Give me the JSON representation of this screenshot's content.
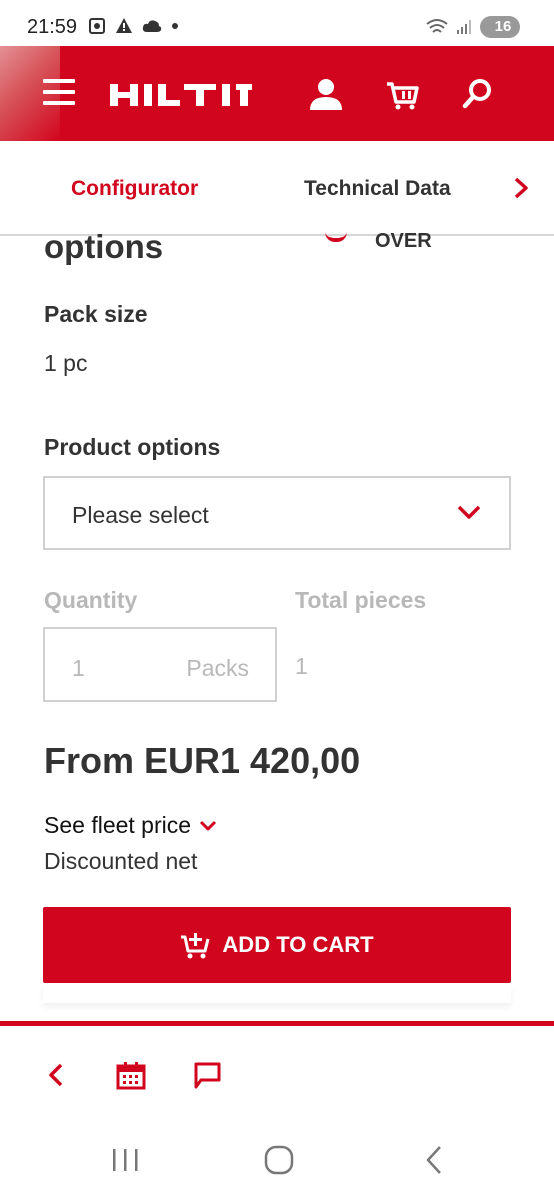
{
  "status": {
    "time": "21:59",
    "battery": "16"
  },
  "header": {
    "logo": "HILTI"
  },
  "tabs": {
    "configurator": "Configurator",
    "technical": "Technical Data"
  },
  "content": {
    "partial_heading": "options",
    "partial_badge": "OVER",
    "pack_size_label": "Pack size",
    "pack_size_value": "1 pc",
    "product_options_label": "Product options",
    "product_options_value": "Please select",
    "quantity_label": "Quantity",
    "quantity_value": "1",
    "quantity_unit": "Packs",
    "total_pieces_label": "Total pieces",
    "total_pieces_value": "1",
    "price": "From EUR1 420,00",
    "fleet_link": "See fleet price",
    "discount": "Discounted net",
    "cart_button": "ADD TO CART"
  },
  "colors": {
    "brand_red": "#d2051e",
    "disabled_gray": "#b8b8b8"
  }
}
